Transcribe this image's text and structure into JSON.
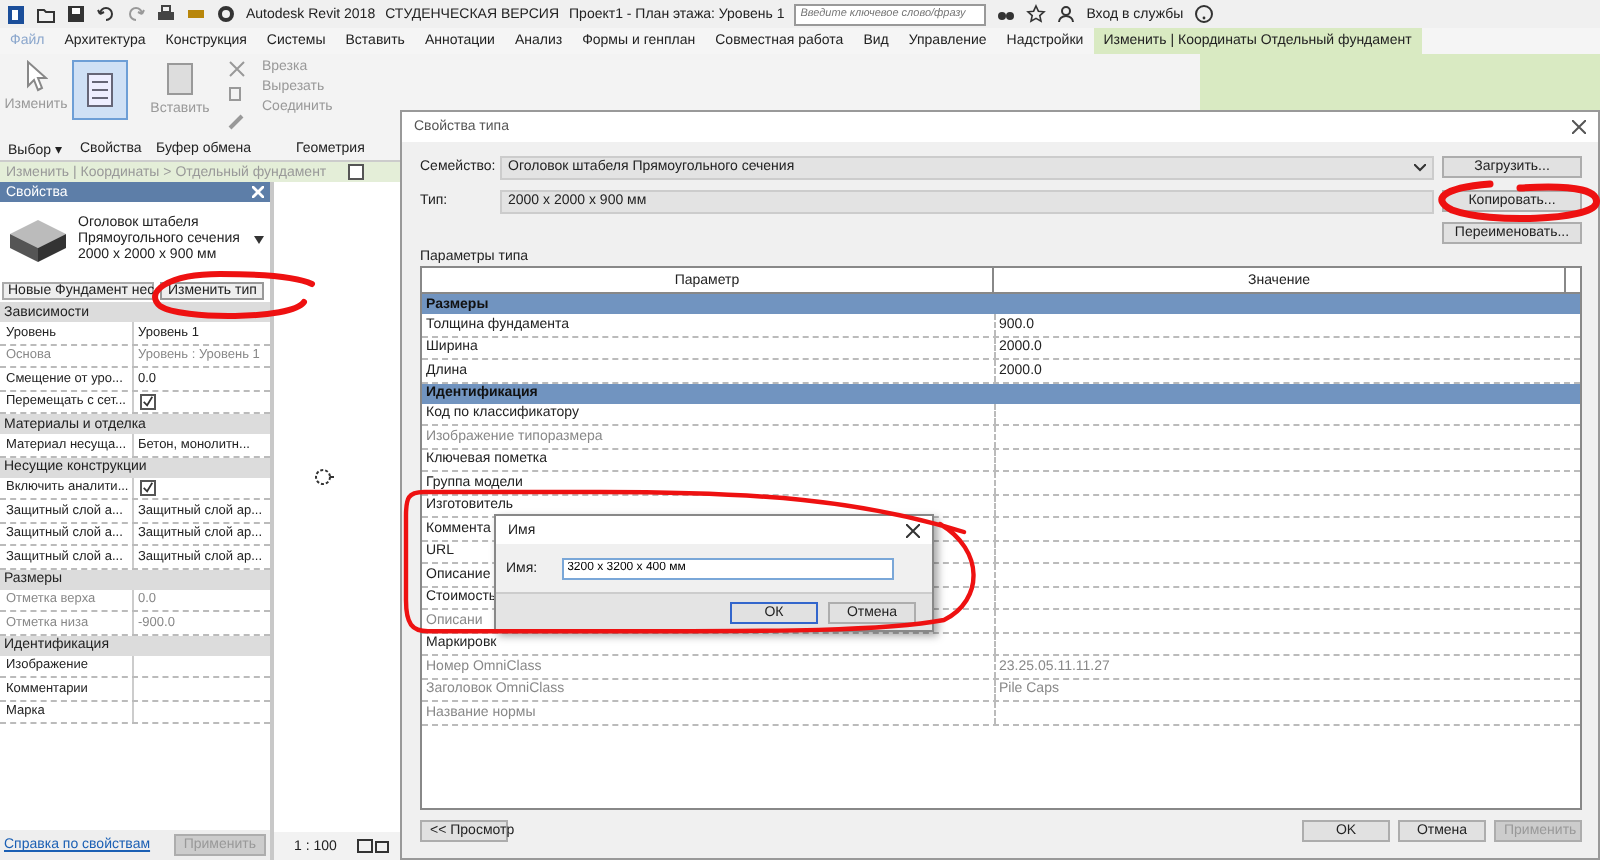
{
  "title_bar": {
    "app_title": "Autodesk Revit 2018",
    "edition": "СТУДЕНЧЕСКАЯ ВЕРСИЯ",
    "document": "Проект1 - План этажа: Уровень 1",
    "search": {
      "placeholder": "Введите ключевое слово/фразу"
    },
    "sign_in": "Вход в службы"
  },
  "ribbon_tabs": [
    {
      "label": "Файл",
      "selected": false
    },
    {
      "label": "Архитектура",
      "selected": false
    },
    {
      "label": "Конструкция",
      "selected": false
    },
    {
      "label": "Системы",
      "selected": false
    },
    {
      "label": "Вставить",
      "selected": false
    },
    {
      "label": "Аннотации",
      "selected": false
    },
    {
      "label": "Анализ",
      "selected": false
    },
    {
      "label": "Формы и генплан",
      "selected": false
    },
    {
      "label": "Совместная работа",
      "selected": false
    },
    {
      "label": "Вид",
      "selected": false
    },
    {
      "label": "Управление",
      "selected": false
    },
    {
      "label": "Надстройки",
      "selected": false
    },
    {
      "label": "Изменить | Координаты Отдельный фундамент",
      "selected": true
    }
  ],
  "ribbon": {
    "modify": "Изменить",
    "paste": "Вставить",
    "geometry_tools": [
      {
        "label": "Врезка"
      },
      {
        "label": "Вырезать"
      },
      {
        "label": "Соединить"
      }
    ],
    "panels": [
      {
        "label": "Выбор ▾"
      },
      {
        "label": "Свойства"
      },
      {
        "label": "Буфер обмена"
      },
      {
        "label": "Геометрия"
      }
    ]
  },
  "context_bar": {
    "text": "Изменить | Координаты > Отдельный фундамент",
    "checked": false
  },
  "properties": {
    "title": "Свойства",
    "type_lines": [
      "Оголовок штабеля",
      "Прямоугольного сечения",
      "2000 x 2000 x 900 мм"
    ],
    "filter": "Новые Фундамент нес",
    "edit_type": "Изменить тип",
    "groups": [
      {
        "name": "Зависимости",
        "rows": [
          {
            "name": "Уровень",
            "kind": "text",
            "value": "Уровень 1",
            "disabled": false
          },
          {
            "name": "Основа",
            "kind": "text",
            "value": "Уровень : Уровень 1",
            "disabled": true
          },
          {
            "name": "Смещение от уро...",
            "kind": "text",
            "value": "0.0",
            "disabled": false
          },
          {
            "name": "Перемещать с сет...",
            "kind": "check",
            "checked": true,
            "disabled": false
          }
        ]
      },
      {
        "name": "Материалы и отделка",
        "rows": [
          {
            "name": "Материал несуща...",
            "kind": "text",
            "value": "Бетон, монолитн...",
            "disabled": false
          }
        ]
      },
      {
        "name": "Несущие конструкции",
        "rows": [
          {
            "name": "Включить аналити...",
            "kind": "check",
            "checked": true,
            "disabled": false
          },
          {
            "name": "Защитный слой а...",
            "kind": "text",
            "value": "Защитный слой ар...",
            "disabled": false
          },
          {
            "name": "Защитный слой а...",
            "kind": "text",
            "value": "Защитный слой ар...",
            "disabled": false
          },
          {
            "name": "Защитный слой а...",
            "kind": "text",
            "value": "Защитный слой ар...",
            "disabled": false
          }
        ]
      },
      {
        "name": "Размеры",
        "rows": [
          {
            "name": "Отметка верха",
            "kind": "text",
            "value": "0.0",
            "disabled": true
          },
          {
            "name": "Отметка низа",
            "kind": "text",
            "value": "-900.0",
            "disabled": true
          }
        ]
      },
      {
        "name": "Идентификация",
        "rows": [
          {
            "name": "Изображение",
            "kind": "text",
            "disabled": false
          },
          {
            "name": "Комментарии",
            "kind": "text",
            "disabled": false
          },
          {
            "name": "Марка",
            "kind": "text",
            "disabled": false
          }
        ]
      }
    ],
    "help_link": "Справка по свойствам",
    "apply": {
      "label": "Применить",
      "disabled": true
    }
  },
  "view": {
    "scale": "1 : 100"
  },
  "type_dialog": {
    "title": "Свойства типа",
    "family_label": "Семейство:",
    "family": "Оголовок штабеля Прямоугольного сечения",
    "load": "Загрузить...",
    "type_label": "Тип:",
    "type": "2000 x 2000 x 900 мм",
    "duplicate": "Копировать...",
    "rename": "Переименовать...",
    "params_label": "Параметры типа",
    "columns": [
      "Параметр",
      "Значение"
    ],
    "groups": [
      {
        "name": "Размеры",
        "rows": [
          {
            "name": "Толщина фундамента",
            "value": "900.0",
            "disabled": false
          },
          {
            "name": "Ширина",
            "value": "2000.0",
            "disabled": false
          },
          {
            "name": "Длина",
            "value": "2000.0",
            "disabled": false
          }
        ]
      },
      {
        "name": "Идентификация",
        "rows": [
          {
            "name": "Код по классификатору",
            "disabled": false
          },
          {
            "name": "Изображение типоразмера",
            "disabled": true
          },
          {
            "name": "Ключевая пометка",
            "disabled": false
          },
          {
            "name": "Группа модели",
            "disabled": false
          },
          {
            "name": "Изготовитель",
            "disabled": false
          },
          {
            "name": "Коммента",
            "disabled": false
          },
          {
            "name": "URL",
            "disabled": false
          },
          {
            "name": "Описание",
            "disabled": false
          },
          {
            "name": "Стоимость",
            "disabled": false
          },
          {
            "name": "Описани",
            "disabled": true
          },
          {
            "name": "Маркировк",
            "disabled": false
          },
          {
            "name": "Номер OmniClass",
            "value": "23.25.05.11.11.27",
            "disabled": true
          },
          {
            "name": "Заголовок OmniClass",
            "value": "Pile Caps",
            "disabled": true
          },
          {
            "name": "Название нормы",
            "disabled": true
          }
        ]
      }
    ],
    "preview": "<< Просмотр",
    "buttons": [
      {
        "label": "OK",
        "disabled": false
      },
      {
        "label": "Отмена",
        "disabled": false
      },
      {
        "label": "Применить",
        "disabled": true
      }
    ]
  },
  "name_dialog": {
    "title": "Имя",
    "label": "Имя:",
    "value": "3200 x 3200 x 400 мм",
    "buttons": [
      {
        "label": "ОК",
        "focused": true
      },
      {
        "label": "Отмена",
        "focused": false
      }
    ]
  }
}
